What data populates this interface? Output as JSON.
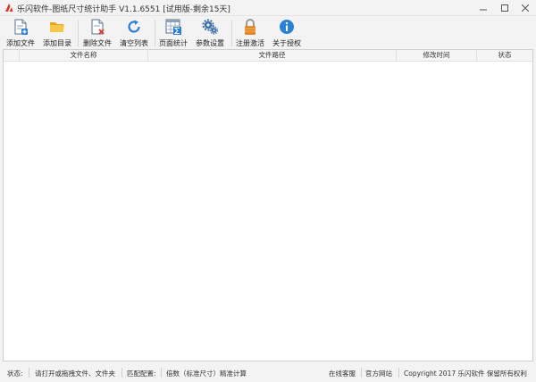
{
  "window": {
    "title": "乐闪软件-图纸尺寸统计助手 V1.1.6551 [试用版-剩余15天]"
  },
  "toolbar": {
    "buttons": [
      {
        "label": "添加文件",
        "icon": "add-file-icon"
      },
      {
        "label": "添加目录",
        "icon": "folder-icon"
      },
      {
        "label": "删除文件",
        "icon": "delete-file-icon"
      },
      {
        "label": "清空列表",
        "icon": "refresh-icon"
      },
      {
        "label": "页面统计",
        "icon": "sum-table-icon"
      },
      {
        "label": "参数设置",
        "icon": "gears-icon"
      },
      {
        "label": "注册激活",
        "icon": "lock-icon"
      },
      {
        "label": "关于授权",
        "icon": "info-icon"
      }
    ]
  },
  "table": {
    "columns": [
      "文件名称",
      "文件路径",
      "修改时间",
      "状态"
    ],
    "rows": []
  },
  "statusbar": {
    "status_label": "状态:",
    "status_text": "请打开或拖拽文件、文件夹",
    "config_label": "匹配配置:",
    "config_value": "倍数（标准尺寸）精准计算",
    "online_service": "在线客服",
    "official_site": "官方网站",
    "copyright": "Copyright 2017 乐闪软件 保留所有权利"
  },
  "colors": {
    "accent_blue": "#2b7fd4",
    "folder_yellow": "#f0b429",
    "delete_red": "#d9382c",
    "lock_orange": "#e08a2c"
  }
}
